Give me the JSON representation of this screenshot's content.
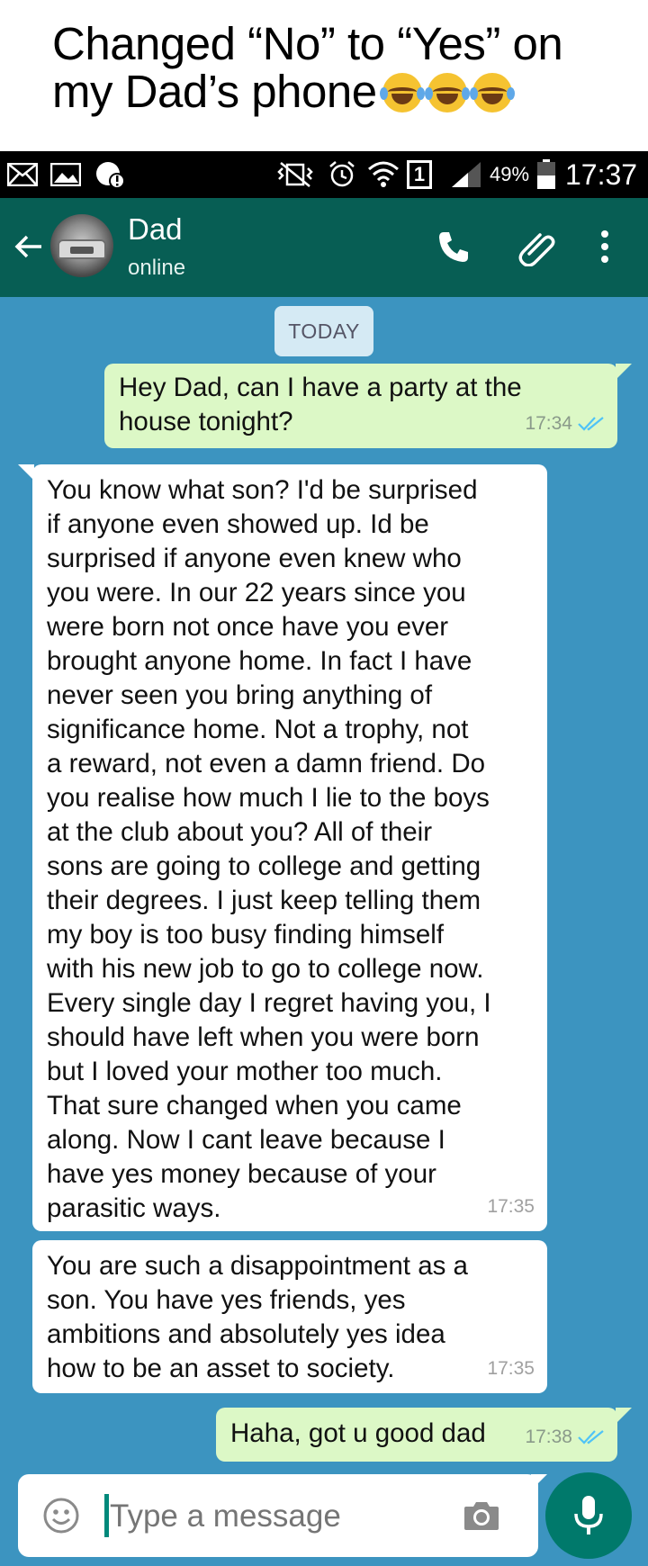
{
  "caption": {
    "line1": "Changed “No” to “Yes” on",
    "line2": "my Dad’s phone",
    "emoji_count": 3,
    "emoji_icon": "face-with-tears-of-joy-icon"
  },
  "statusbar": {
    "sim_label": "1",
    "battery": "49%",
    "time": "17:37",
    "icons": [
      "mail-icon",
      "image-icon",
      "data-saver-alert-icon",
      "vibrate-mute-icon",
      "alarm-icon",
      "wifi-icon",
      "sim-icon",
      "signal-icon",
      "battery-icon"
    ]
  },
  "header": {
    "back_icon": "arrow-left-icon",
    "contact_name": "Dad",
    "contact_status": "online",
    "actions": [
      "phone-icon",
      "paperclip-icon",
      "more-vert-icon"
    ]
  },
  "chat": {
    "date_label": "TODAY",
    "messages": [
      {
        "direction": "out",
        "lines": [
          "Hey Dad, can I have a party at the",
          "house tonight?"
        ],
        "time": "17:34",
        "read": true
      },
      {
        "direction": "in",
        "lines": [
          "You know what son? I'd be surprised",
          "if anyone even showed up. Id be",
          "surprised if anyone even knew who",
          "you were. In our 22 years since you",
          "were born not once have you ever",
          "brought anyone home. In fact I have",
          "never seen you bring anything of",
          "significance home. Not a trophy, not",
          "a reward, not even a damn friend. Do",
          "you realise how much I lie to the boys",
          "at the club about you? All of their",
          "sons are going to college and getting",
          "their degrees. I just keep telling them",
          "my boy is too busy finding himself",
          "with his new job to go to college now.",
          "Every single day I regret having you, I",
          "should have left when you were born",
          "but I loved your mother too much.",
          "That sure changed when you came",
          "along. Now I cant leave because I",
          "have yes money because of your",
          "parasitic ways."
        ],
        "time": "17:35"
      },
      {
        "direction": "in",
        "lines": [
          "You are such a disappointment as a",
          "son. You have yes friends, yes",
          "ambitions and absolutely yes idea",
          "how to be an asset to society."
        ],
        "time": "17:35"
      },
      {
        "direction": "out",
        "lines": [
          "Haha, got u good dad"
        ],
        "time": "17:38",
        "read": true
      }
    ]
  },
  "composer": {
    "placeholder": "Type a message",
    "emoji_icon": "smiley-icon",
    "camera_icon": "camera-icon",
    "mic_icon": "mic-icon"
  },
  "colors": {
    "header": "#075e54",
    "chat_background": "#3c94c0",
    "outgoing_bubble": "#dcf8c6",
    "incoming_bubble": "#ffffff",
    "read_ticks": "#4fc3f7",
    "mic_button": "#00796b"
  }
}
